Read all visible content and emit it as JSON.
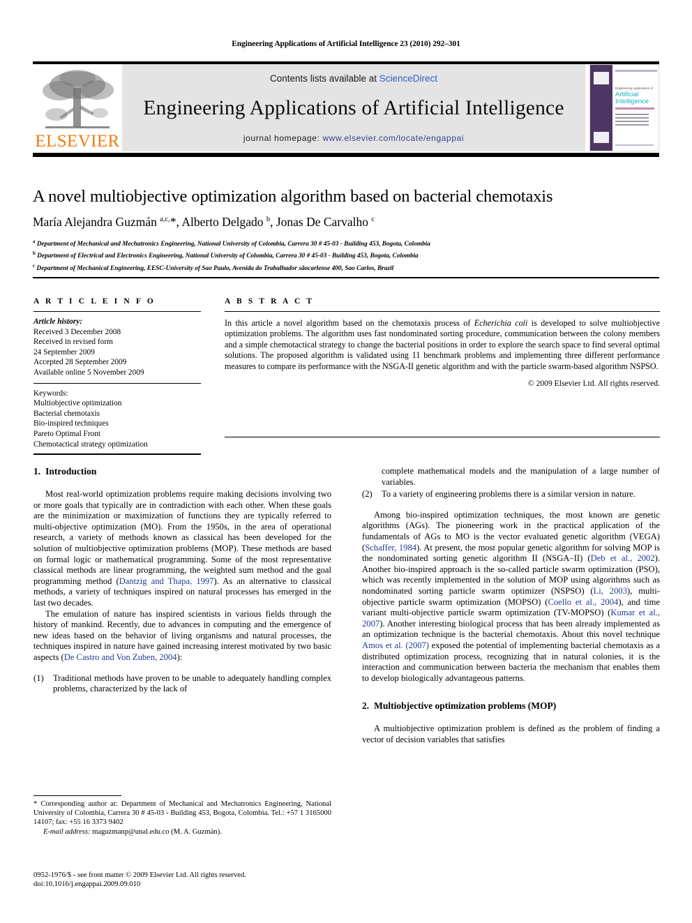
{
  "running_head": "Engineering Applications of Artificial Intelligence 23 (2010) 292–301",
  "masthead": {
    "publisher_logo_text": "ELSEVIER",
    "contents_prefix": "Contents lists available at ",
    "contents_link": "ScienceDirect",
    "journal_name": "Engineering Applications of Artificial Intelligence",
    "homepage_prefix": "journal homepage: ",
    "homepage_url": "www.elsevier.com/locate/engappai",
    "cover": {
      "line_small": "Engineering Applications of",
      "title_1": "Artificial",
      "title_2": "Intelligence"
    },
    "accent_color": "#ef7b10",
    "link_color": "#2f5fc4",
    "banner_bg": "#e4e4e4"
  },
  "article": {
    "title": "A novel multiobjective optimization algorithm based on bacterial chemotaxis",
    "authors_html": "María Alejandra Guzmán <sup>a,c,</sup>*, Alberto Delgado <sup>b</sup>, Jonas De Carvalho <sup>c</sup>",
    "affiliations": [
      {
        "mark": "a",
        "text": "Department of Mechanical and Mechatronics Engineering, National University of Colombia, Carrera 30 # 45-03 - Building 453, Bogota, Colombia"
      },
      {
        "mark": "b",
        "text": "Department of Electrical and Electronics Engineering, National University of Colombia, Carrera 30 # 45-03 - Building 453, Bogota, Colombia"
      },
      {
        "mark": "c",
        "text": "Department of Mechanical Engineering, EESC-University of Sao Paulo, Avenida do Trabalhador sãocarlense 400, Sao Carlos, Brazil"
      }
    ]
  },
  "article_info": {
    "heading": "A R T I C L E   I N F O",
    "history_label": "Article history:",
    "history": [
      "Received 3 December 2008",
      "Received in revised form",
      "24 September 2009",
      "Accepted 28 September 2009",
      "Available online 5 November 2009"
    ],
    "keywords_label": "Keywords:",
    "keywords": [
      "Multiobjective optimization",
      "Bacterial chemotaxis",
      "Bio-inspired techniques",
      "Pareto Optimal Front",
      "Chemotactical strategy optimization"
    ]
  },
  "abstract": {
    "heading": "A B S T R A C T",
    "body_html": "In this article a novel algorithm based on the chemotaxis process of <i>Echerichia coli</i> is developed to solve multiobjective optimization problems. The algorithm uses fast nondominated sorting procedure, communication between the colony members and a simple chemotactical strategy to change the bacterial positions in order to explore the search space to find several optimal solutions. The proposed algorithm is validated using 11 benchmark problems and implementing three different performance measures to compare its performance with the NSGA-II genetic algorithm and with the particle swarm-based algorithm NSPSO.",
    "copyright": "© 2009 Elsevier Ltd. All rights reserved."
  },
  "body": {
    "section1": {
      "number": "1.",
      "title": "Introduction",
      "paragraphs_html": [
        "Most real-world optimization problems require making decisions involving two or more goals that typically are in contradiction with each other. When these goals are the minimization or maximization of functions they are typically referred to multi-objective optimization (MO). From the 1950s, in the area of operational research, a variety of methods known as classical has been developed for the solution of multiobjective optimization problems (MOP). These methods are based on formal logic or mathematical programming. Some of the most representative classical methods are linear programming, the weighted sum method and the goal programming method (<span class=\"cite\">Dantzig and Thapa, 1997</span>). As an alternative to classical methods, a variety of techniques inspired on natural processes has emerged in the last two decades.",
        "The emulation of nature has inspired scientists in various fields through the history of mankind. Recently, due to advances in computing and the emergence of new ideas based on the behavior of living organisms and natural processes, the techniques inspired in nature have gained increasing interest motivated by two basic aspects (<span class=\"cite\">De Castro and Von Zuben, 2004</span>):"
      ],
      "list": [
        {
          "num": "(1)",
          "text": "Traditional methods have proven to be unable to adequately handling complex problems, characterized by the lack of complete mathematical models and the manipulation of a large number of variables."
        },
        {
          "num": "(2)",
          "text": "To a variety of engineering problems there is a similar version in nature."
        }
      ],
      "paragraph_after_list_html": "Among bio-inspired optimization techniques, the most known are genetic algorithms (AGs). The pioneering work in the practical application of the fundamentals of AGs to MO is the vector evaluated genetic algorithm (VEGA) (<span class=\"cite\">Schaffer, 1984</span>). At present, the most popular genetic algorithm for solving MOP is the nondominated sorting genetic algorithm II (NSGA–II) (<span class=\"cite\">Deb et al., 2002</span>). Another bio-inspired approach is the so-called particle swarm optimization (PSO), which was recently implemented in the solution of MOP using algorithms such as nondominated sorting particle swarm optimizer (NSPSO) (<span class=\"cite\">Li, 2003</span>), multi-objective particle swarm optimization (MOPSO) (<span class=\"cite\">Coello et al., 2004</span>), and time variant multi-objective particle swarm optimization (TV-MOPSO) (<span class=\"cite\">Kumar et al., 2007</span>). Another interesting biological process that has been already implemented as an optimization technique is the bacterial chemotaxis. About this novel technique <span class=\"cite\">Amos et al. (2007)</span> exposed the potential of implementing bacterial chemotaxis as a distributed optimization process, recognizing that in natural colonies, it is the interaction and communication between bacteria the mechanism that enables them to develop biologically advantageous patterns."
    },
    "section2": {
      "number": "2.",
      "title": "Multiobjective optimization problems (MOP)",
      "paragraph": "A multiobjective optimization problem is defined as the problem of finding a vector of decision variables that satisfies"
    }
  },
  "footnote": {
    "corresponding_html": "<span class=\"star\">*</span> Corresponding author at: Department of Mechanical and Mechatronics Engineering, National University of Colombia, Carrera 30 # 45-03 - Building 453, Bogota, Colombia. Tel.: +57 1 3165000 14107; fax: +55 16 3373 9402",
    "email_html": "<span class=\"email-label\">E-mail address:</span> maguzmanp@unal.edu.co (M. A. Guzmán)."
  },
  "footer": {
    "issn_line": "0952-1976/$ - see front matter © 2009 Elsevier Ltd. All rights reserved.",
    "doi_line": "doi:10.1016/j.engappai.2009.09.010"
  }
}
